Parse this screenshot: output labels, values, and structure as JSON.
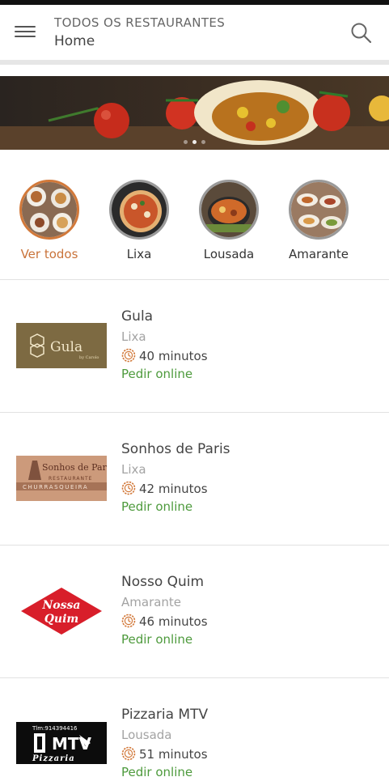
{
  "header": {
    "title": "TODOS OS RESTAURANTES",
    "subtitle": "Home"
  },
  "icons": {
    "menu": "menu-icon",
    "search": "search-icon",
    "clock": "clock-icon"
  },
  "banner": {
    "slides": 3,
    "active_slide": 1
  },
  "cities": [
    {
      "label": "Ver todos",
      "active": true
    },
    {
      "label": "Lixa",
      "active": false
    },
    {
      "label": "Lousada",
      "active": false
    },
    {
      "label": "Amarante",
      "active": false
    }
  ],
  "restaurants": [
    {
      "name": "Gula",
      "location": "Lixa",
      "time": "40 minutos",
      "order_label": "Pedir online"
    },
    {
      "name": "Sonhos de Paris",
      "location": "Lixa",
      "time": "42 minutos",
      "order_label": "Pedir online"
    },
    {
      "name": "Nosso Quim",
      "location": "Amarante",
      "time": "46 minutos",
      "order_label": "Pedir online"
    },
    {
      "name": "Pizzaria MTV",
      "location": "Lousada",
      "time": "51 minutos",
      "order_label": "Pedir online"
    }
  ],
  "logos": {
    "gula": "Gula",
    "gula_sub": "by Carolo",
    "sonhos_line1": "Sonhos de Paris",
    "sonhos_line2": "RESTAURANTE",
    "sonhos_line3": "CHURRASQUEIRA",
    "nosso_line1": "Nossa",
    "nosso_line2": "Quim",
    "mtv_phone": "Tlm:914394416",
    "mtv_brand": "MTV",
    "mtv_sub": "Pizzaria"
  },
  "colors": {
    "accent_orange": "#d2793a",
    "order_green": "#4d9a3c",
    "muted_text": "#a3a3a3"
  }
}
